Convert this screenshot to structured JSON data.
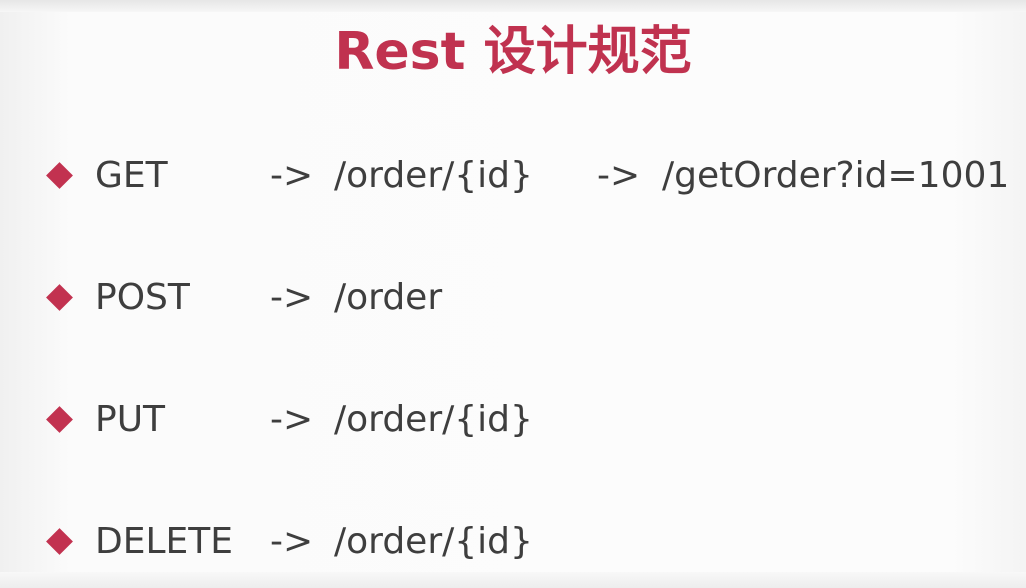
{
  "slide": {
    "title": "Rest 设计规范",
    "rows": [
      {
        "method": "GET",
        "arrow": "->",
        "path": "/order/{id}",
        "alt_arrow": "->",
        "alt_path": "/getOrder?id=1001"
      },
      {
        "method": "POST",
        "arrow": "->",
        "path": "/order"
      },
      {
        "method": "PUT",
        "arrow": "->",
        "path": "/order/{id}"
      },
      {
        "method": "DELETE",
        "arrow": "->",
        "path": "/order/{id}"
      }
    ]
  },
  "colors": {
    "accent": "#c0324f",
    "bullet": "#c23250",
    "text": "#3e3e3e",
    "background": "#fcfcfc"
  },
  "icons": {
    "bullet": "diamond-bullet-icon"
  }
}
